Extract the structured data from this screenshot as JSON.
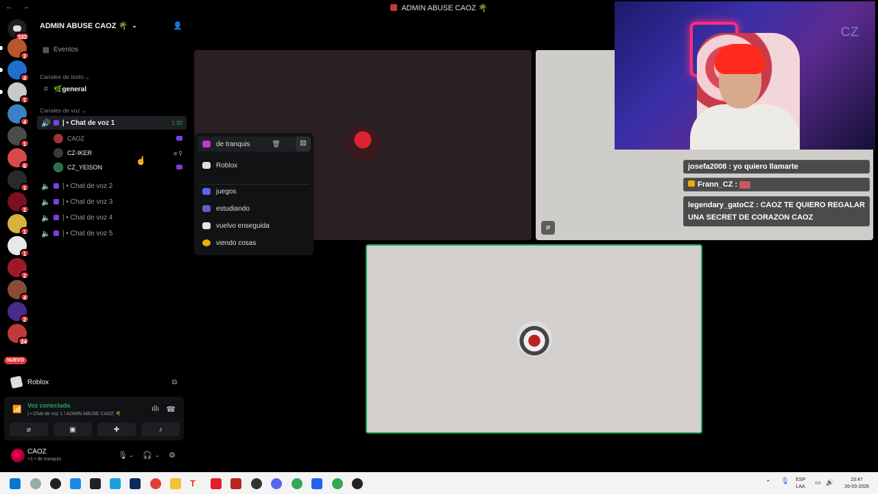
{
  "window": {
    "title": "ADMIN ABUSE CAOZ 🌴",
    "back": "←",
    "forward": "→"
  },
  "rail": {
    "home_badge": "333",
    "servers": [
      {
        "badge": "2",
        "color": "#b8572b"
      },
      {
        "badge": "4",
        "color": "#1f6fd1"
      },
      {
        "badge": "1",
        "color": "#c9c9c9"
      },
      {
        "badge": "4",
        "color": "#3b82c4"
      },
      {
        "badge": "1",
        "color": "#4b4b4b"
      },
      {
        "badge": "6",
        "color": "#d64a4a"
      },
      {
        "badge": "1",
        "color": "#2a2a2a"
      },
      {
        "badge": "1",
        "color": "#7a1020"
      },
      {
        "badge": "1",
        "color": "#d8b33b"
      },
      {
        "badge": "1",
        "color": "#e8e8e8"
      },
      {
        "badge": "2",
        "color": "#a01828"
      },
      {
        "badge": "4",
        "color": "#8a4a3a"
      },
      {
        "badge": "2",
        "color": "#4a2a8a"
      },
      {
        "badge": "24",
        "color": "#c03a3a"
      }
    ],
    "new_label": "NUEVO"
  },
  "guild": {
    "name": "ADMIN ABUSE CAOZ 🌴",
    "events": "Eventos",
    "text_category": "Canales de texto",
    "general": "🌿general",
    "voice_category": "Canales de voz",
    "voice_channels": [
      {
        "name": "| • Chat de voz 1",
        "time": "1:20"
      },
      {
        "name": "| • Chat de voz 2"
      },
      {
        "name": "| • Chat de voz 3"
      },
      {
        "name": "| • Chat de voz 4"
      },
      {
        "name": "| • Chat de voz 5"
      }
    ],
    "users": [
      {
        "name": "CAOZ"
      },
      {
        "name": "CZ-IKER"
      },
      {
        "name": "CZ_YEISON"
      }
    ]
  },
  "activity": {
    "name": "Roblox"
  },
  "voice": {
    "title": "Voz conectada",
    "subtitle": "| • Chat de voz 1 / ADMIN ABUSE CAOZ 🌴"
  },
  "user": {
    "name": "CAOZ",
    "status": "+1 • de tranquis"
  },
  "status_menu": {
    "items": [
      "de tranquis",
      "Roblox",
      "juegos",
      "estudiando",
      "vuelvo enseguida",
      "viendo cosas"
    ],
    "colors": [
      "#c636c9",
      "#dbdee1",
      "#5865f2",
      "#6a5acd",
      "#e6e6e6",
      "#e8b100"
    ]
  },
  "chat": [
    {
      "text": "josefa2008 : yo quiero llamarte"
    },
    {
      "text": "Frann_CZ :"
    },
    {
      "text": "legendary_gatoCZ : CAOZ TE QUIERO REGALAR UNA SECRET DE CORAZON CAOZ"
    }
  ],
  "cam": {
    "watermark": "CZ"
  },
  "taskbar": {
    "lang": "ESP",
    "lang2": "LAA",
    "time": "23:47",
    "date": "26-03-2026"
  }
}
